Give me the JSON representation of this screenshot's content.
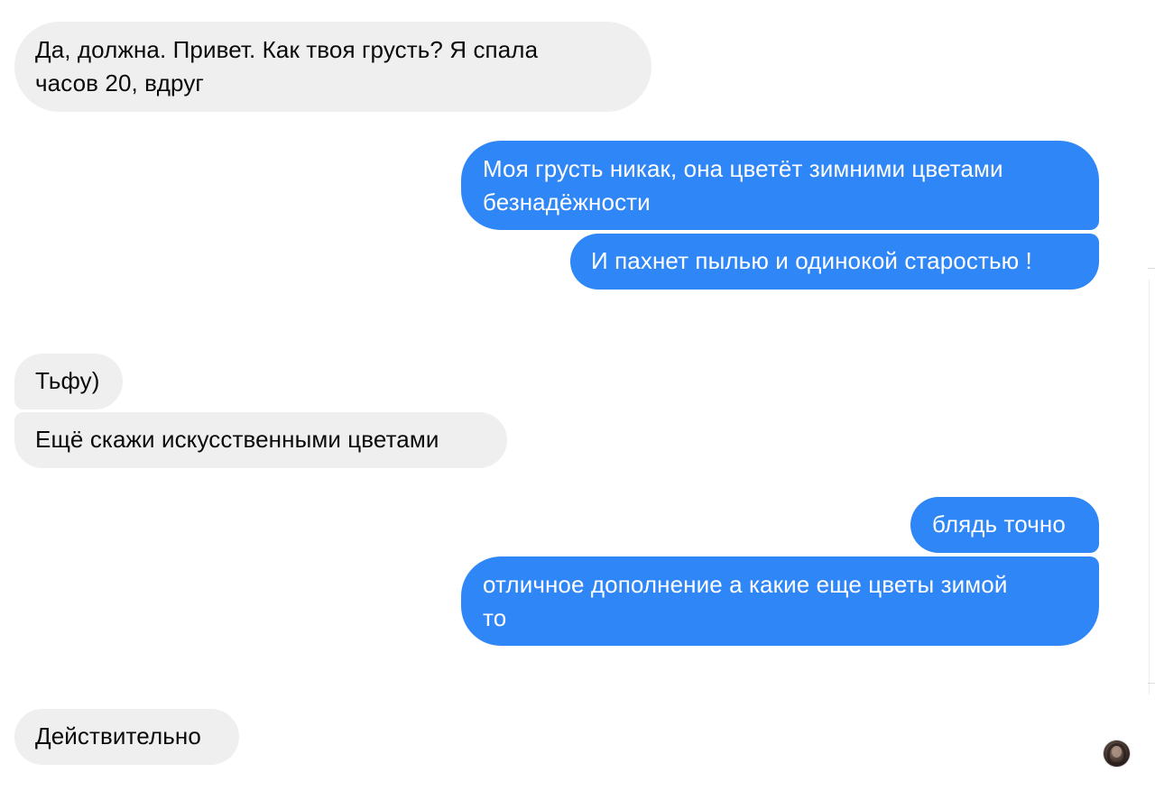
{
  "colors": {
    "incoming_bubble": "#efefef",
    "outgoing_bubble": "#2f86f6",
    "incoming_text": "#0a0a0a",
    "outgoing_text": "#ffffff"
  },
  "messages": [
    {
      "direction": "incoming",
      "lines": [
        "Да, должна. Привет. Как твоя грусть? Я спала",
        "часов 20, вдруг"
      ]
    },
    {
      "direction": "outgoing",
      "lines": [
        "Моя грусть никак, она цветёт зимними цветами",
        "безнадёжности"
      ]
    },
    {
      "direction": "outgoing",
      "lines": [
        "И пахнет пылью и одинокой старостью !"
      ]
    },
    {
      "direction": "incoming",
      "lines": [
        "Тьфу)"
      ]
    },
    {
      "direction": "incoming",
      "lines": [
        "Ещё скажи искусственными цветами"
      ]
    },
    {
      "direction": "outgoing",
      "lines": [
        "блядь точно"
      ]
    },
    {
      "direction": "outgoing",
      "lines": [
        "отличное дополнение а какие еще цветы зимой",
        "то"
      ]
    },
    {
      "direction": "incoming",
      "lines": [
        "Действительно"
      ]
    }
  ],
  "read_receipt": {
    "icon": "avatar-icon"
  }
}
